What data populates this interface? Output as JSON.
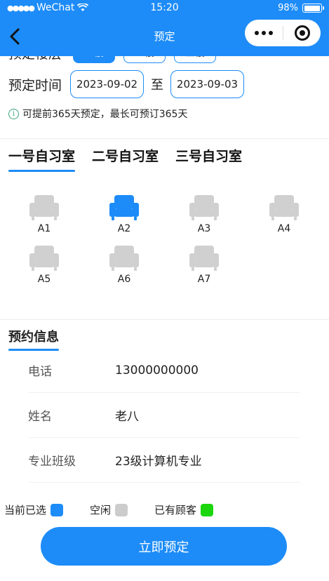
{
  "status_bar": {
    "carrier": "WeChat",
    "time": "15:20",
    "battery": "98%",
    "battery_level": 0.98
  },
  "nav": {
    "title": "预定"
  },
  "floor": {
    "label": "预定楼层",
    "options": [
      "一楼",
      "二楼",
      "三楼"
    ],
    "selected_index": 0
  },
  "date": {
    "label": "预定时间",
    "start": "2023-09-02",
    "separator": "至",
    "end": "2023-09-03"
  },
  "tip": {
    "icon": "info-icon",
    "text": "可提前365天预定，最长可预订365天"
  },
  "rooms": {
    "tabs": [
      "一号自习室",
      "二号自习室",
      "三号自习室"
    ],
    "active_index": 0
  },
  "seats": [
    {
      "label": "A1",
      "status": "free"
    },
    {
      "label": "A2",
      "status": "selected"
    },
    {
      "label": "A3",
      "status": "free"
    },
    {
      "label": "A4",
      "status": "free"
    },
    {
      "label": "A5",
      "status": "free"
    },
    {
      "label": "A6",
      "status": "free"
    },
    {
      "label": "A7",
      "status": "free"
    }
  ],
  "booking_info": {
    "title": "预约信息",
    "fields": [
      {
        "label": "电话",
        "value": "13000000000"
      },
      {
        "label": "姓名",
        "value": "老八"
      },
      {
        "label": "专业班级",
        "value": "23级计算机专业"
      }
    ]
  },
  "legend": [
    {
      "label": "当前已选",
      "color": "#1d8cf8"
    },
    {
      "label": "空闲",
      "color": "#cccccc"
    },
    {
      "label": "已有顾客",
      "color": "#1bd60d"
    }
  ],
  "submit_label": "立即预定",
  "colors": {
    "accent": "#1d8cf8",
    "seat_free": "#d0d0d0",
    "seat_selected": "#1d8cf8",
    "seat_occupied": "#1bd60d"
  }
}
